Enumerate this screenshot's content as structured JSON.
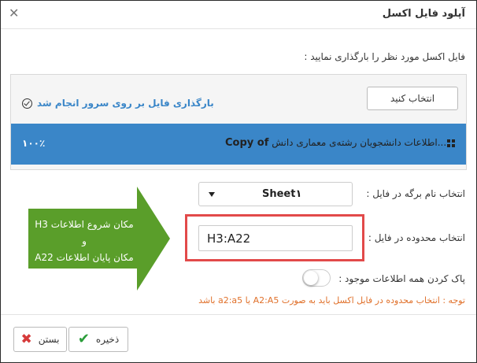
{
  "dialog": {
    "title": "آپلود فایل اکسل",
    "close_glyph": "✕"
  },
  "upload": {
    "prompt": "فایل اکسل مورد نظر را بارگذاری نمایید :",
    "select_button": "انتخاب کنید",
    "status_text": "بارگذاری فایل بر روی سرور انجام شد",
    "progress_text": "۱۰۰٪",
    "progress_value": 1.0,
    "file_prefix": "Copy of",
    "file_name": "اطلاعات دانشجویان رشته‌ی معماری دانش..."
  },
  "sheet": {
    "label": "انتخاب نام برگه در فایل :",
    "selected": "Sheet۱"
  },
  "range": {
    "label": "انتخاب محدوده در فایل :",
    "value": "H3:A22"
  },
  "clear": {
    "label": "پاک کردن همه اطلاعات موجود :",
    "enabled": false
  },
  "note": "توجه : انتخاب محدوده در فایل اکسل باید به صورت A2:A5 یا a2:a5 باشد",
  "callout": {
    "line1": "مکان شروع اطلاعات H3",
    "line2": "و",
    "line3": "مکان پایان اطلاعات A22",
    "color": "#5a9e2a"
  },
  "footer": {
    "save_label": "ذخیره",
    "close_label": "بستن"
  },
  "colors": {
    "accent": "#3a86c8",
    "highlight": "#e24a4a",
    "note": "#e0702a"
  }
}
